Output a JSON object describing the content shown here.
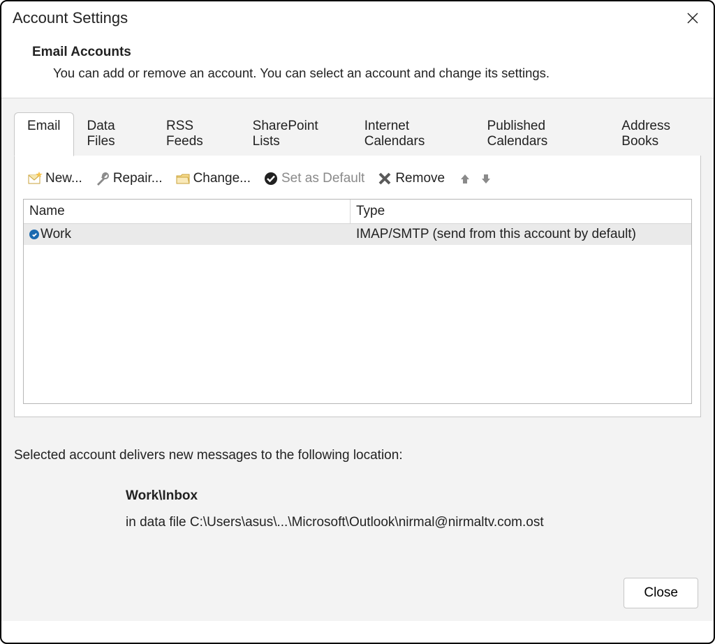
{
  "window": {
    "title": "Account Settings"
  },
  "heading": {
    "title": "Email Accounts",
    "desc": "You can add or remove an account. You can select an account and change its settings."
  },
  "tabs": [
    {
      "label": "Email",
      "active": true
    },
    {
      "label": "Data Files"
    },
    {
      "label": "RSS Feeds"
    },
    {
      "label": "SharePoint Lists"
    },
    {
      "label": "Internet Calendars"
    },
    {
      "label": "Published Calendars"
    },
    {
      "label": "Address Books"
    }
  ],
  "toolbar": {
    "new": "New...",
    "repair": "Repair...",
    "change": "Change...",
    "default": "Set as Default",
    "remove": "Remove"
  },
  "table": {
    "columns": {
      "name": "Name",
      "type": "Type"
    },
    "rows": [
      {
        "name": "Work",
        "type": "IMAP/SMTP (send from this account by default)",
        "default": true
      }
    ]
  },
  "delivery": {
    "label": "Selected account delivers new messages to the following location:",
    "folder": "Work\\Inbox",
    "path": "in data file C:\\Users\\asus\\...\\Microsoft\\Outlook\\nirmal@nirmaltv.com.ost"
  },
  "footer": {
    "close": "Close"
  }
}
